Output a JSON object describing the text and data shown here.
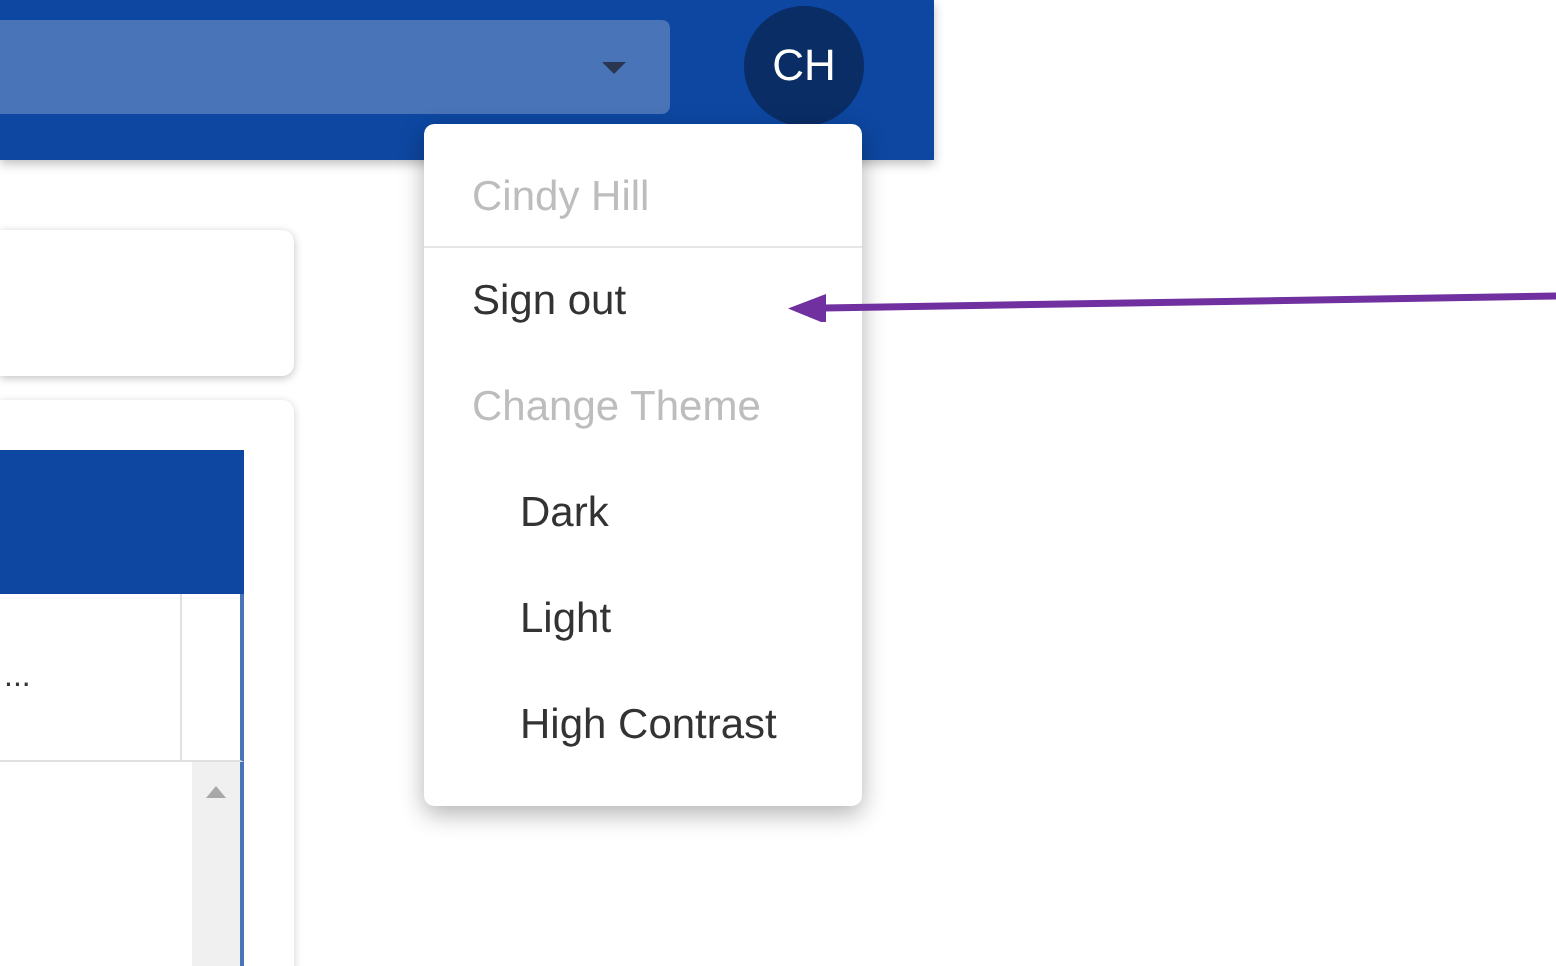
{
  "header": {
    "avatar": {
      "initials": "CH"
    }
  },
  "table": {
    "row_text": "..."
  },
  "user_menu": {
    "items": [
      {
        "kind": "header",
        "label": "Cindy Hill"
      },
      {
        "kind": "action",
        "label": "Sign out"
      },
      {
        "kind": "section",
        "label": "Change Theme"
      },
      {
        "kind": "option",
        "label": "Dark"
      },
      {
        "kind": "option",
        "label": "Light"
      },
      {
        "kind": "option",
        "label": "High Contrast"
      }
    ]
  }
}
